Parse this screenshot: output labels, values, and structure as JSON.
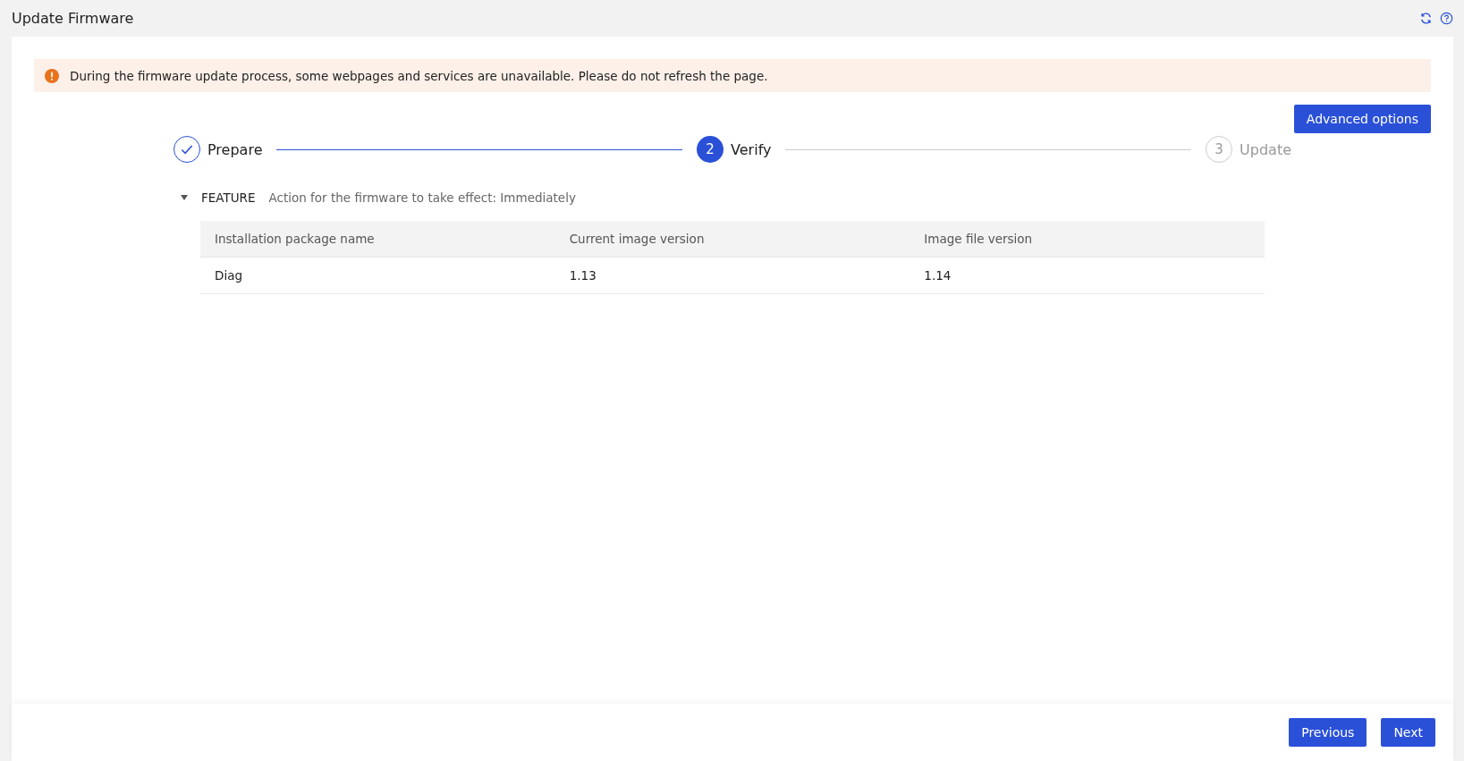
{
  "page": {
    "title": "Update Firmware"
  },
  "alert": {
    "text": "During the firmware update process, some webpages and services are unavailable. Please do not refresh the page."
  },
  "advanced_button": "Advanced options",
  "steps": [
    {
      "label": "Prepare",
      "kind": "done"
    },
    {
      "number": "2",
      "label": "Verify",
      "kind": "active"
    },
    {
      "number": "3",
      "label": "Update",
      "kind": "pending"
    }
  ],
  "section": {
    "name": "FEATURE",
    "expanded": true,
    "description": "Action for the firmware to take effect: Immediately"
  },
  "table": {
    "columns": [
      "Installation package name",
      "Current image version",
      "Image file version"
    ],
    "rows": [
      [
        "Diag",
        "1.13",
        "1.14"
      ]
    ]
  },
  "footer": {
    "buttons": [
      "Previous",
      "Next"
    ]
  }
}
